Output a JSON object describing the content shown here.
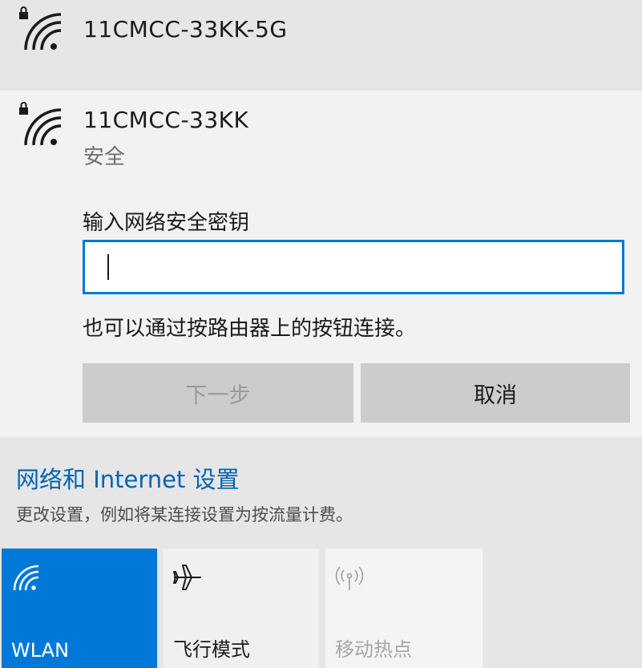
{
  "networks": [
    {
      "name": "11CMCC-33KK-5G"
    },
    {
      "name": "11CMCC-33KK",
      "status": "安全"
    }
  ],
  "connect_form": {
    "key_label": "输入网络安全密钥",
    "key_value": "",
    "hint": "也可以通过按路由器上的按钮连接。",
    "next_label": "下一步",
    "cancel_label": "取消"
  },
  "settings": {
    "link_label": "网络和 Internet 设置",
    "description": "更改设置，例如将某连接设置为按流量计费。"
  },
  "quick_actions": [
    {
      "label": "WLAN",
      "icon": "wifi-icon",
      "state": "on"
    },
    {
      "label": "飞行模式",
      "icon": "airplane-icon",
      "state": "off"
    },
    {
      "label": "移动热点",
      "icon": "mobile-hotspot-icon",
      "state": "disabled"
    }
  ],
  "colors": {
    "accent": "#0078d7",
    "link": "#0063b1",
    "panel": "#e6e6e6",
    "expanded_panel": "#f2f2f2"
  }
}
